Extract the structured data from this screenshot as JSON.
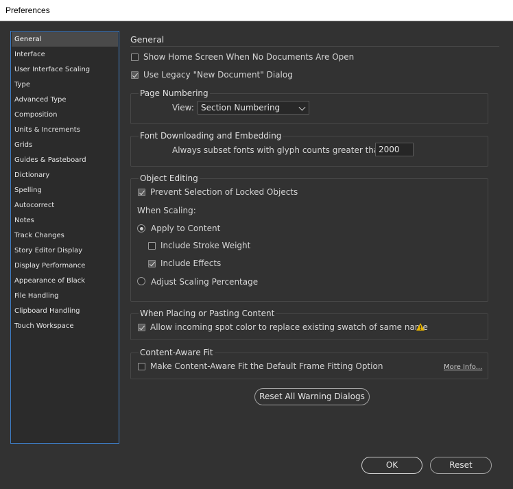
{
  "window": {
    "title": "Preferences"
  },
  "sidebar": {
    "items": [
      {
        "label": "General",
        "selected": true
      },
      {
        "label": "Interface"
      },
      {
        "label": "User Interface Scaling"
      },
      {
        "label": "Type"
      },
      {
        "label": "Advanced Type"
      },
      {
        "label": "Composition"
      },
      {
        "label": "Units & Increments"
      },
      {
        "label": "Grids"
      },
      {
        "label": "Guides & Pasteboard"
      },
      {
        "label": "Dictionary"
      },
      {
        "label": "Spelling"
      },
      {
        "label": "Autocorrect"
      },
      {
        "label": "Notes"
      },
      {
        "label": "Track Changes"
      },
      {
        "label": "Story Editor Display"
      },
      {
        "label": "Display Performance"
      },
      {
        "label": "Appearance of Black"
      },
      {
        "label": "File Handling"
      },
      {
        "label": "Clipboard Handling"
      },
      {
        "label": "Touch Workspace"
      }
    ]
  },
  "main": {
    "title": "General",
    "show_home_screen": {
      "label": "Show Home Screen When No Documents Are Open",
      "checked": false
    },
    "use_legacy_dialog": {
      "label": "Use Legacy \"New Document\" Dialog",
      "checked": true
    }
  },
  "page_numbering": {
    "title": "Page Numbering",
    "view_label": "View:",
    "view_value": "Section Numbering"
  },
  "font_downloading": {
    "title": "Font Downloading and Embedding",
    "subset_label": "Always subset fonts with glyph counts greater than:",
    "subset_value": "2000"
  },
  "object_editing": {
    "title": "Object Editing",
    "prevent_selection": {
      "label": "Prevent Selection of Locked Objects",
      "checked": true
    },
    "when_scaling_label": "When Scaling:",
    "apply_to_content": {
      "label": "Apply to Content",
      "selected": true
    },
    "include_stroke_weight": {
      "label": "Include Stroke Weight",
      "checked": false
    },
    "include_effects": {
      "label": "Include Effects",
      "checked": true
    },
    "adjust_scaling": {
      "label": "Adjust Scaling Percentage",
      "selected": false
    }
  },
  "placing": {
    "title": "When Placing or Pasting Content",
    "allow_spot_color": {
      "label": "Allow incoming spot color to replace existing swatch of same name",
      "checked": true
    },
    "warning_icon": "warning-triangle-icon",
    "warning_color": "#e8b400"
  },
  "content_aware": {
    "title": "Content-Aware Fit",
    "make_default": {
      "label": "Make Content-Aware Fit the Default Frame Fitting Option",
      "checked": false
    },
    "more_info": "More Info..."
  },
  "buttons": {
    "reset_warnings": "Reset All Warning Dialogs",
    "ok": "OK",
    "reset": "Reset"
  },
  "colors": {
    "background": "#323232",
    "sidebar_border": "#3d7cc4",
    "selected_item": "#4a4a4a"
  }
}
